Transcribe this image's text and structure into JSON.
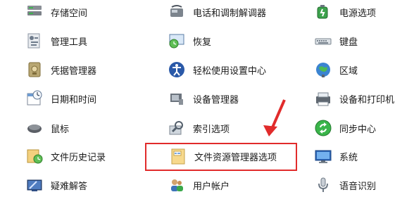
{
  "control_panel": {
    "items": [
      {
        "label": "存储空间",
        "icon": "storage-spaces-icon"
      },
      {
        "label": "电话和调制解调器",
        "icon": "phone-modem-icon"
      },
      {
        "label": "电源选项",
        "icon": "power-options-icon"
      },
      {
        "label": "管理工具",
        "icon": "admin-tools-icon"
      },
      {
        "label": "恢复",
        "icon": "recovery-icon"
      },
      {
        "label": "键盘",
        "icon": "keyboard-icon"
      },
      {
        "label": "凭据管理器",
        "icon": "credential-manager-icon"
      },
      {
        "label": "轻松使用设置中心",
        "icon": "ease-of-access-icon"
      },
      {
        "label": "区域",
        "icon": "region-globe-icon"
      },
      {
        "label": "日期和时间",
        "icon": "date-time-icon"
      },
      {
        "label": "设备管理器",
        "icon": "device-manager-icon"
      },
      {
        "label": "设备和打印机",
        "icon": "devices-printers-icon"
      },
      {
        "label": "鼠标",
        "icon": "mouse-icon"
      },
      {
        "label": "索引选项",
        "icon": "indexing-options-icon"
      },
      {
        "label": "同步中心",
        "icon": "sync-center-icon"
      },
      {
        "label": "文件历史记录",
        "icon": "file-history-icon"
      },
      {
        "label": "文件资源管理器选项",
        "icon": "explorer-options-icon"
      },
      {
        "label": "系统",
        "icon": "system-monitor-icon"
      },
      {
        "label": "疑难解答",
        "icon": "troubleshooting-icon"
      },
      {
        "label": "用户帐户",
        "icon": "user-accounts-icon"
      },
      {
        "label": "语音识别",
        "icon": "microphone-icon"
      }
    ]
  },
  "annotation": {
    "highlight_color": "#e12b2b"
  }
}
